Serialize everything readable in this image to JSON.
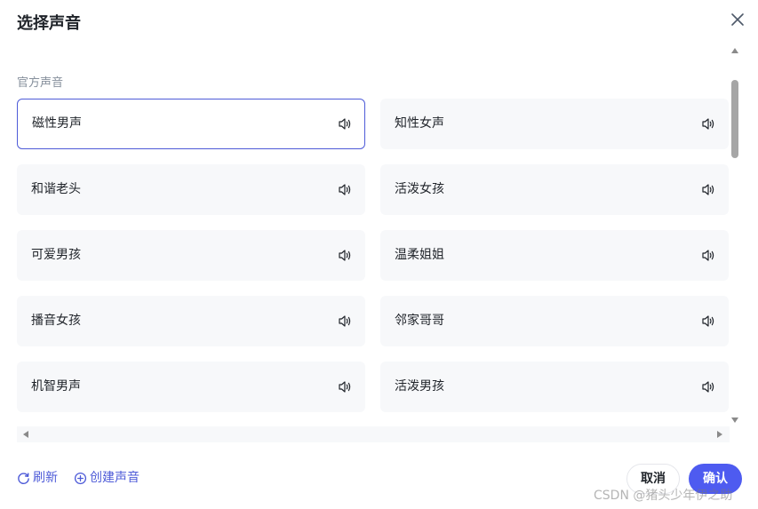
{
  "dialog": {
    "title": "选择声音",
    "section_label": "官方声音"
  },
  "voices": [
    {
      "label": "磁性男声",
      "selected": true
    },
    {
      "label": "知性女声",
      "selected": false
    },
    {
      "label": "和谐老头",
      "selected": false
    },
    {
      "label": "活泼女孩",
      "selected": false
    },
    {
      "label": "可爱男孩",
      "selected": false
    },
    {
      "label": "温柔姐姐",
      "selected": false
    },
    {
      "label": "播音女孩",
      "selected": false
    },
    {
      "label": "邻家哥哥",
      "selected": false
    },
    {
      "label": "机智男声",
      "selected": false
    },
    {
      "label": "活泼男孩",
      "selected": false
    }
  ],
  "footer": {
    "refresh_label": "刷新",
    "create_label": "创建声音",
    "cancel_label": "取消",
    "confirm_label": "确认"
  },
  "watermark": "CSDN @猪头少年伊之助",
  "icons": {
    "close": "close-icon",
    "speaker": "speaker-icon",
    "refresh": "refresh-icon",
    "add": "plus-circle-icon"
  },
  "colors": {
    "accent": "#4e5bf0",
    "selected_border": "#4e5bd8",
    "card_bg": "#f7f8fa",
    "muted_text": "#86909c"
  }
}
